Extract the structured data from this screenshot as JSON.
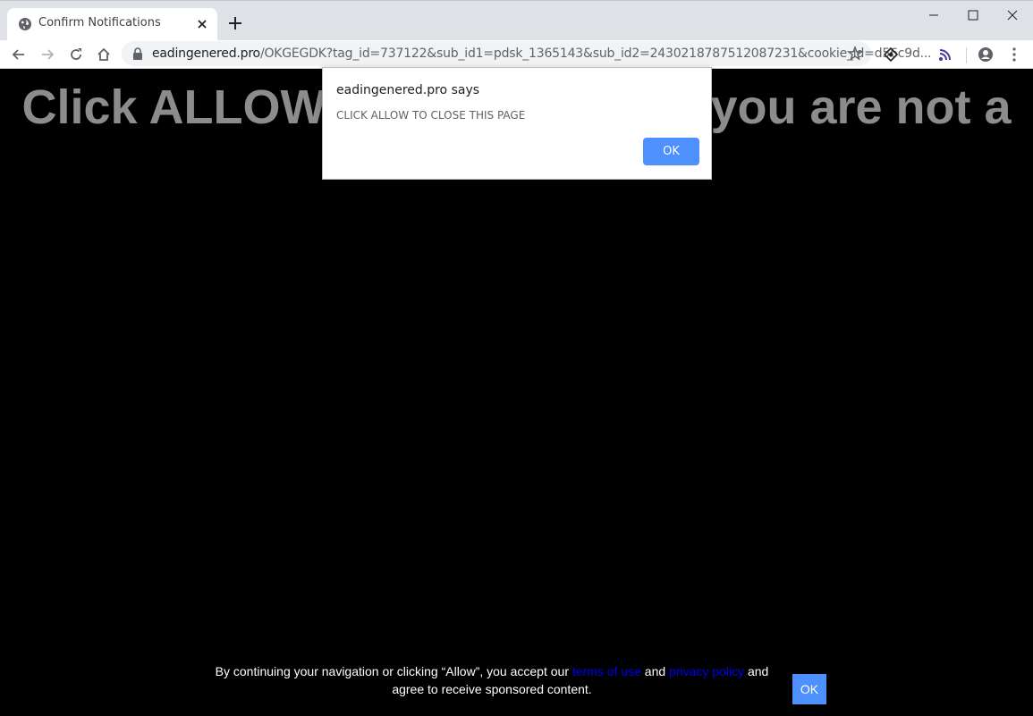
{
  "tab": {
    "title": "Confirm Notifications",
    "favicon": "globe-icon"
  },
  "window_controls": [
    "minimize-icon",
    "maximize-icon",
    "close-icon"
  ],
  "toolbar": {
    "url_host": "eadingenered.pro",
    "url_path": "/OKGEGDK?tag_id=737122&sub_id1=pdsk_1365143&sub_id2=2430218787512087231&cookie_id=d56c9d..."
  },
  "page": {
    "headline_left": "Click ALLOW",
    "headline_right": "you are not a",
    "headline_color": "#8c8c8c",
    "footer_before": "By continuing your navigation or clicking “Allow”, you accept our",
    "footer_link_terms": "terms of use",
    "footer_and": "and",
    "footer_link_privacy": "privacy policy",
    "footer_after": "and agree to receive sponsored content.",
    "footer_ok": "OK",
    "accent": "#4d90fe"
  },
  "dialog": {
    "title": "eadingenered.pro says",
    "message": "CLICK ALLOW TO CLOSE THIS PAGE",
    "ok_label": "OK"
  }
}
